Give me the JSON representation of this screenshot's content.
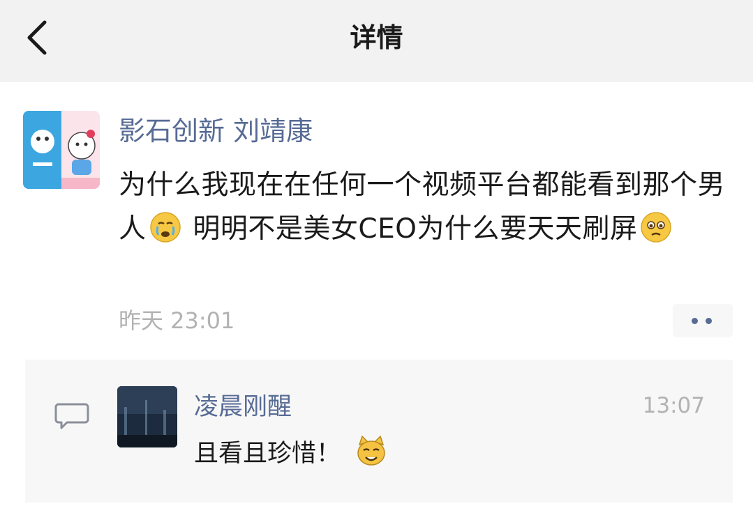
{
  "nav": {
    "title": "详情",
    "back_icon": "chevron-left-icon"
  },
  "post": {
    "author": "影石创新 刘靖康",
    "text_part1": "为什么我现在在任何一个视频平台都能看到那个男人",
    "text_part2": " 明明不是美女CEO为什么要天天刷屏",
    "emoji_1": "crying-face-emoji",
    "emoji_2": "teary-face-emoji",
    "timestamp": "昨天 23:01",
    "more_icon": "more-dots-icon"
  },
  "comment": {
    "icon": "comment-icon",
    "name": "凌晨刚醒",
    "time": "13:07",
    "text": "且看且珍惜！",
    "emoji": "cat-face-emoji"
  },
  "colors": {
    "link": "#576b95",
    "nav_bg": "#f2f2f2",
    "comment_bg": "#f7f7f7",
    "muted": "#b2b2b2"
  }
}
